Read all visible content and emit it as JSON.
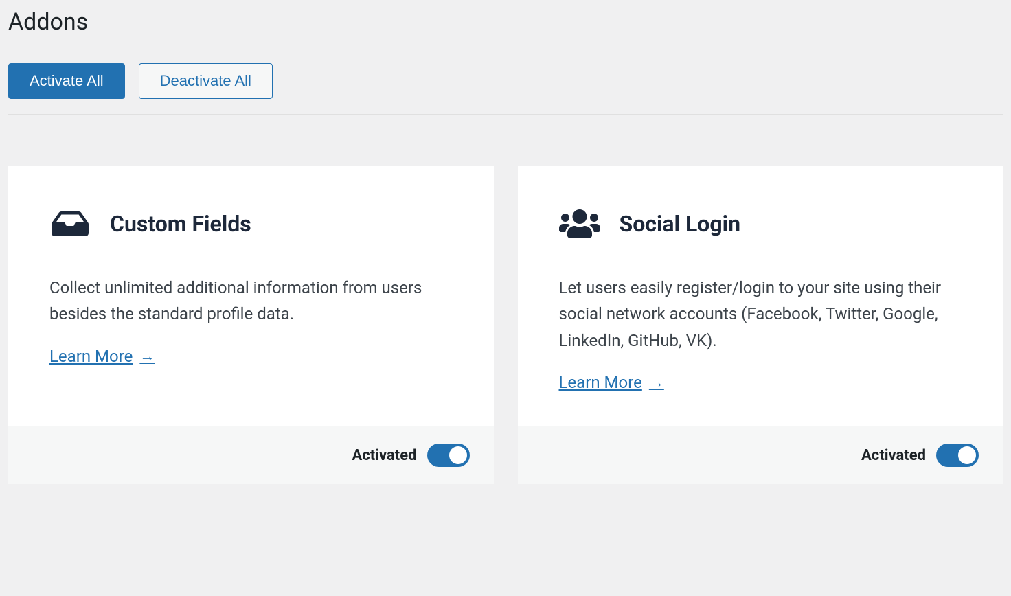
{
  "page_title": "Addons",
  "actions": {
    "activate_all": "Activate All",
    "deactivate_all": "Deactivate All"
  },
  "learn_more_label": "Learn More",
  "addons": [
    {
      "icon": "inbox-icon",
      "title": "Custom Fields",
      "description": "Collect unlimited additional information from users besides the standard profile data.",
      "status_label": "Activated",
      "active": true
    },
    {
      "icon": "users-icon",
      "title": "Social Login",
      "description": "Let users easily register/login to your site using their social network accounts (Facebook, Twitter, Google, LinkedIn, GitHub, VK).",
      "status_label": "Activated",
      "active": true
    }
  ]
}
